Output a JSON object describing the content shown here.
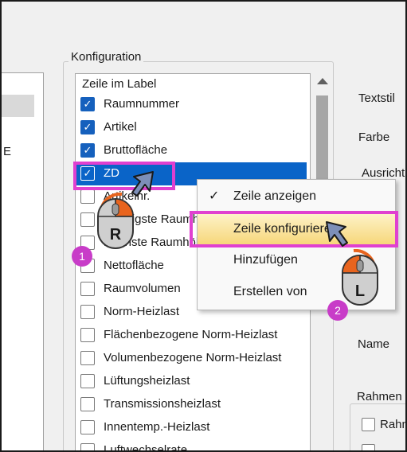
{
  "left_panel": {
    "truncated_text": "E"
  },
  "config_group": {
    "title": "Konfiguration",
    "list_header": "Zeile im Label",
    "rows": [
      {
        "label": "Raumnummer",
        "checked": true
      },
      {
        "label": "Artikel",
        "checked": true
      },
      {
        "label": "Bruttofläche",
        "checked": true
      },
      {
        "label": "ZD",
        "checked": true
      },
      {
        "label": "Artikelnr.",
        "checked": false
      },
      {
        "label": "Niedrigste Raumhöhe",
        "checked": false
      },
      {
        "label": "Höchste Raumhöhe",
        "checked": false
      },
      {
        "label": "Nettofläche",
        "checked": false
      },
      {
        "label": "Raumvolumen",
        "checked": false
      },
      {
        "label": "Norm-Heizlast",
        "checked": false
      },
      {
        "label": "Flächenbezogene Norm-Heizlast",
        "checked": false
      },
      {
        "label": "Volumenbezogene Norm-Heizlast",
        "checked": false
      },
      {
        "label": "Lüftungsheizlast",
        "checked": false
      },
      {
        "label": "Transmissionsheizlast",
        "checked": false
      },
      {
        "label": "Innentemp.-Heizlast",
        "checked": false
      },
      {
        "label": "Luftwechselrate",
        "checked": false
      }
    ],
    "selected_row_index": 3
  },
  "right_panel": {
    "textstil": "Textstil",
    "farbe": "Farbe",
    "ausricht": "Ausricht",
    "name": "Name",
    "rahmen": "Rahmen",
    "rahmen_cb": "Rahm"
  },
  "context_menu": {
    "items": [
      {
        "label": "Zeile anzeigen",
        "checked": true,
        "check_glyph": "✓"
      },
      {
        "label": "Zeile konfigurieren",
        "highlighted": true
      },
      {
        "label": "Hinzufügen"
      },
      {
        "label": "Erstellen von"
      }
    ]
  },
  "annotations": {
    "badge1": "1",
    "badge2": "2",
    "mouse_right_letter": "R",
    "mouse_left_letter": "L"
  },
  "colors": {
    "selection": "#0a64c8",
    "checkbox": "#1560bd",
    "highlight_frame": "#e040d0",
    "badge": "#c83cc8",
    "mouse_accent": "#e8641e"
  },
  "icons": [
    "checkmark-icon",
    "right-mouse-button-icon",
    "left-mouse-button-icon",
    "pointer-cursor-icon",
    "scroll-up-arrow-icon"
  ]
}
